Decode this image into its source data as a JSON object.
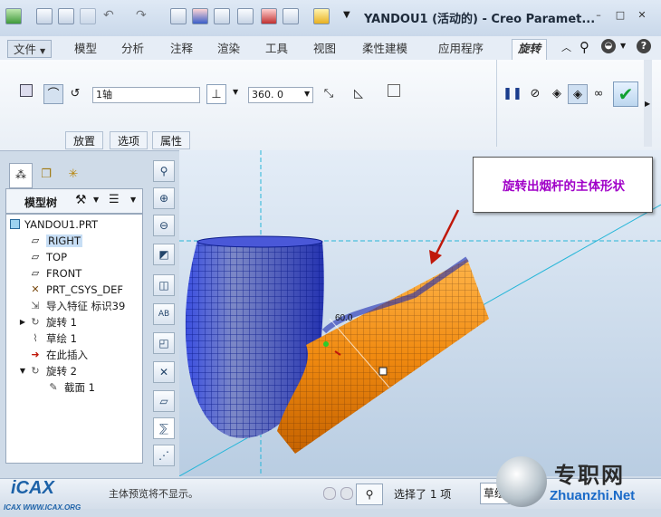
{
  "window": {
    "title": "YANDOU1 (活动的) - Creo Paramet..."
  },
  "ribbon": {
    "tabs": [
      {
        "label": "文件",
        "has_dropdown": true
      },
      {
        "label": "模型"
      },
      {
        "label": "分析"
      },
      {
        "label": "注释"
      },
      {
        "label": "渲染"
      },
      {
        "label": "工具"
      },
      {
        "label": "视图"
      },
      {
        "label": "柔性建模"
      },
      {
        "label": "应用程序"
      },
      {
        "label": "旋转",
        "active": true
      }
    ],
    "axis_field": "1轴",
    "angle_field": "360. 0",
    "subtabs": [
      "放置",
      "选项",
      "属性"
    ]
  },
  "tree": {
    "tabs_icons": [
      "tree-view-icon",
      "layers-icon",
      "favorites-icon"
    ],
    "header_label": "模型树",
    "items": [
      {
        "label": "YANDOU1.PRT",
        "icon": "part-icon",
        "level": 0
      },
      {
        "label": "RIGHT",
        "icon": "datum-plane-icon",
        "level": 1,
        "selected": true
      },
      {
        "label": "TOP",
        "icon": "datum-plane-icon",
        "level": 1
      },
      {
        "label": "FRONT",
        "icon": "datum-plane-icon",
        "level": 1
      },
      {
        "label": "PRT_CSYS_DEF",
        "icon": "csys-icon",
        "level": 1
      },
      {
        "label": "导入特征 标识39",
        "icon": "import-feature-icon",
        "level": 1
      },
      {
        "label": "旋转 1",
        "icon": "revolve-icon",
        "level": 1,
        "expandable": true
      },
      {
        "label": "草绘 1",
        "icon": "sketch-icon",
        "level": 1
      },
      {
        "label": "在此插入",
        "icon": "insert-here-icon",
        "level": 1
      },
      {
        "label": "旋转 2",
        "icon": "revolve-icon",
        "level": 1,
        "expanded": true
      },
      {
        "label": "截面 1",
        "icon": "section-icon",
        "level": 2
      }
    ]
  },
  "graphics": {
    "annotation": "旋转出烟杆的主体形状",
    "dimension": "60.0",
    "colors": {
      "bowl": "#2d3cc8",
      "stem": "#f08a10",
      "axis": "#27b6d8",
      "arrow": "#c0180a",
      "annotation": "#a000c8"
    }
  },
  "status": {
    "message": "主体预览将不显示。",
    "selection": "选择了 1 项",
    "filter": "草绘"
  },
  "watermark": {
    "left": "ICAX WWW.ICAX.ORG",
    "right_cn": "专职网",
    "right_url": "Zhuanzhi.Net"
  }
}
